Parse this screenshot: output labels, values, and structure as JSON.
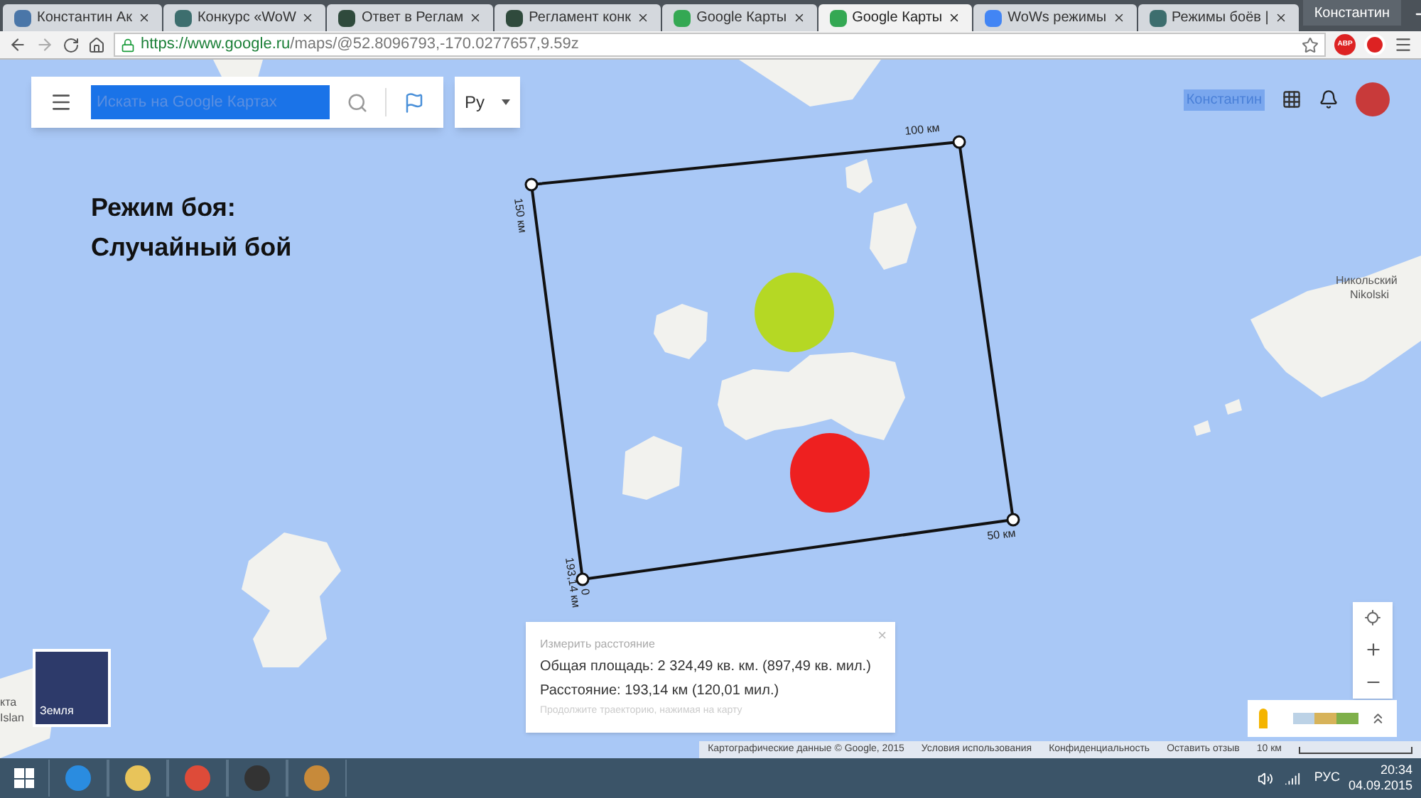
{
  "browser": {
    "tabs": [
      {
        "title": "Константин Ак",
        "kind": "vk",
        "selected": false
      },
      {
        "title": "Конкурс «WoW",
        "kind": "wows",
        "selected": false
      },
      {
        "title": "Ответ в Реглам",
        "kind": "wot",
        "selected": false
      },
      {
        "title": "Регламент конк",
        "kind": "wot",
        "selected": false
      },
      {
        "title": "Google Карты",
        "kind": "maps",
        "selected": false
      },
      {
        "title": "Google Карты",
        "kind": "maps",
        "selected": true
      },
      {
        "title": "WoWs режимы",
        "kind": "google",
        "selected": false
      },
      {
        "title": "Режимы боёв |",
        "kind": "wows",
        "selected": false
      }
    ],
    "user": "Константин",
    "address": {
      "host": "https://www.google.ru",
      "path": "/maps/@52.8096793,-170.0277657,9.59z"
    },
    "extension_badge": "ABP"
  },
  "map": {
    "search": {
      "placeholder": "Искать на Google Картах"
    },
    "language": "Ру",
    "account": "Константин",
    "overlay_title": [
      "Режим боя:",
      "Случайный бой"
    ],
    "place_labels": [
      "Никольский",
      "Nikolski",
      "кта",
      "Islan"
    ],
    "measure_labels": [
      "100 км",
      "150 км",
      "193,14 км",
      "50 км",
      "0"
    ],
    "markers": [
      {
        "color": "#b5d824"
      },
      {
        "color": "#ee2020"
      }
    ],
    "layer_thumb": "Земля",
    "measure_popup": {
      "title": "Измерить расстояние",
      "area": "Общая площадь: 2 324,49 кв. км. (897,49 кв. мил.)",
      "distance": "Расстояние: 193,14 км (120,01 мил.)",
      "hint": "Продолжите траекторию, нажимая на карту",
      "close": "×"
    },
    "footer": [
      "Картографические данные © Google, 2015",
      "Условия использования",
      "Конфиденциальность",
      "Оставить отзыв"
    ],
    "scale": "10 км"
  },
  "taskbar": {
    "language": "РУС",
    "time": "20:34",
    "date": "04.09.2015"
  }
}
